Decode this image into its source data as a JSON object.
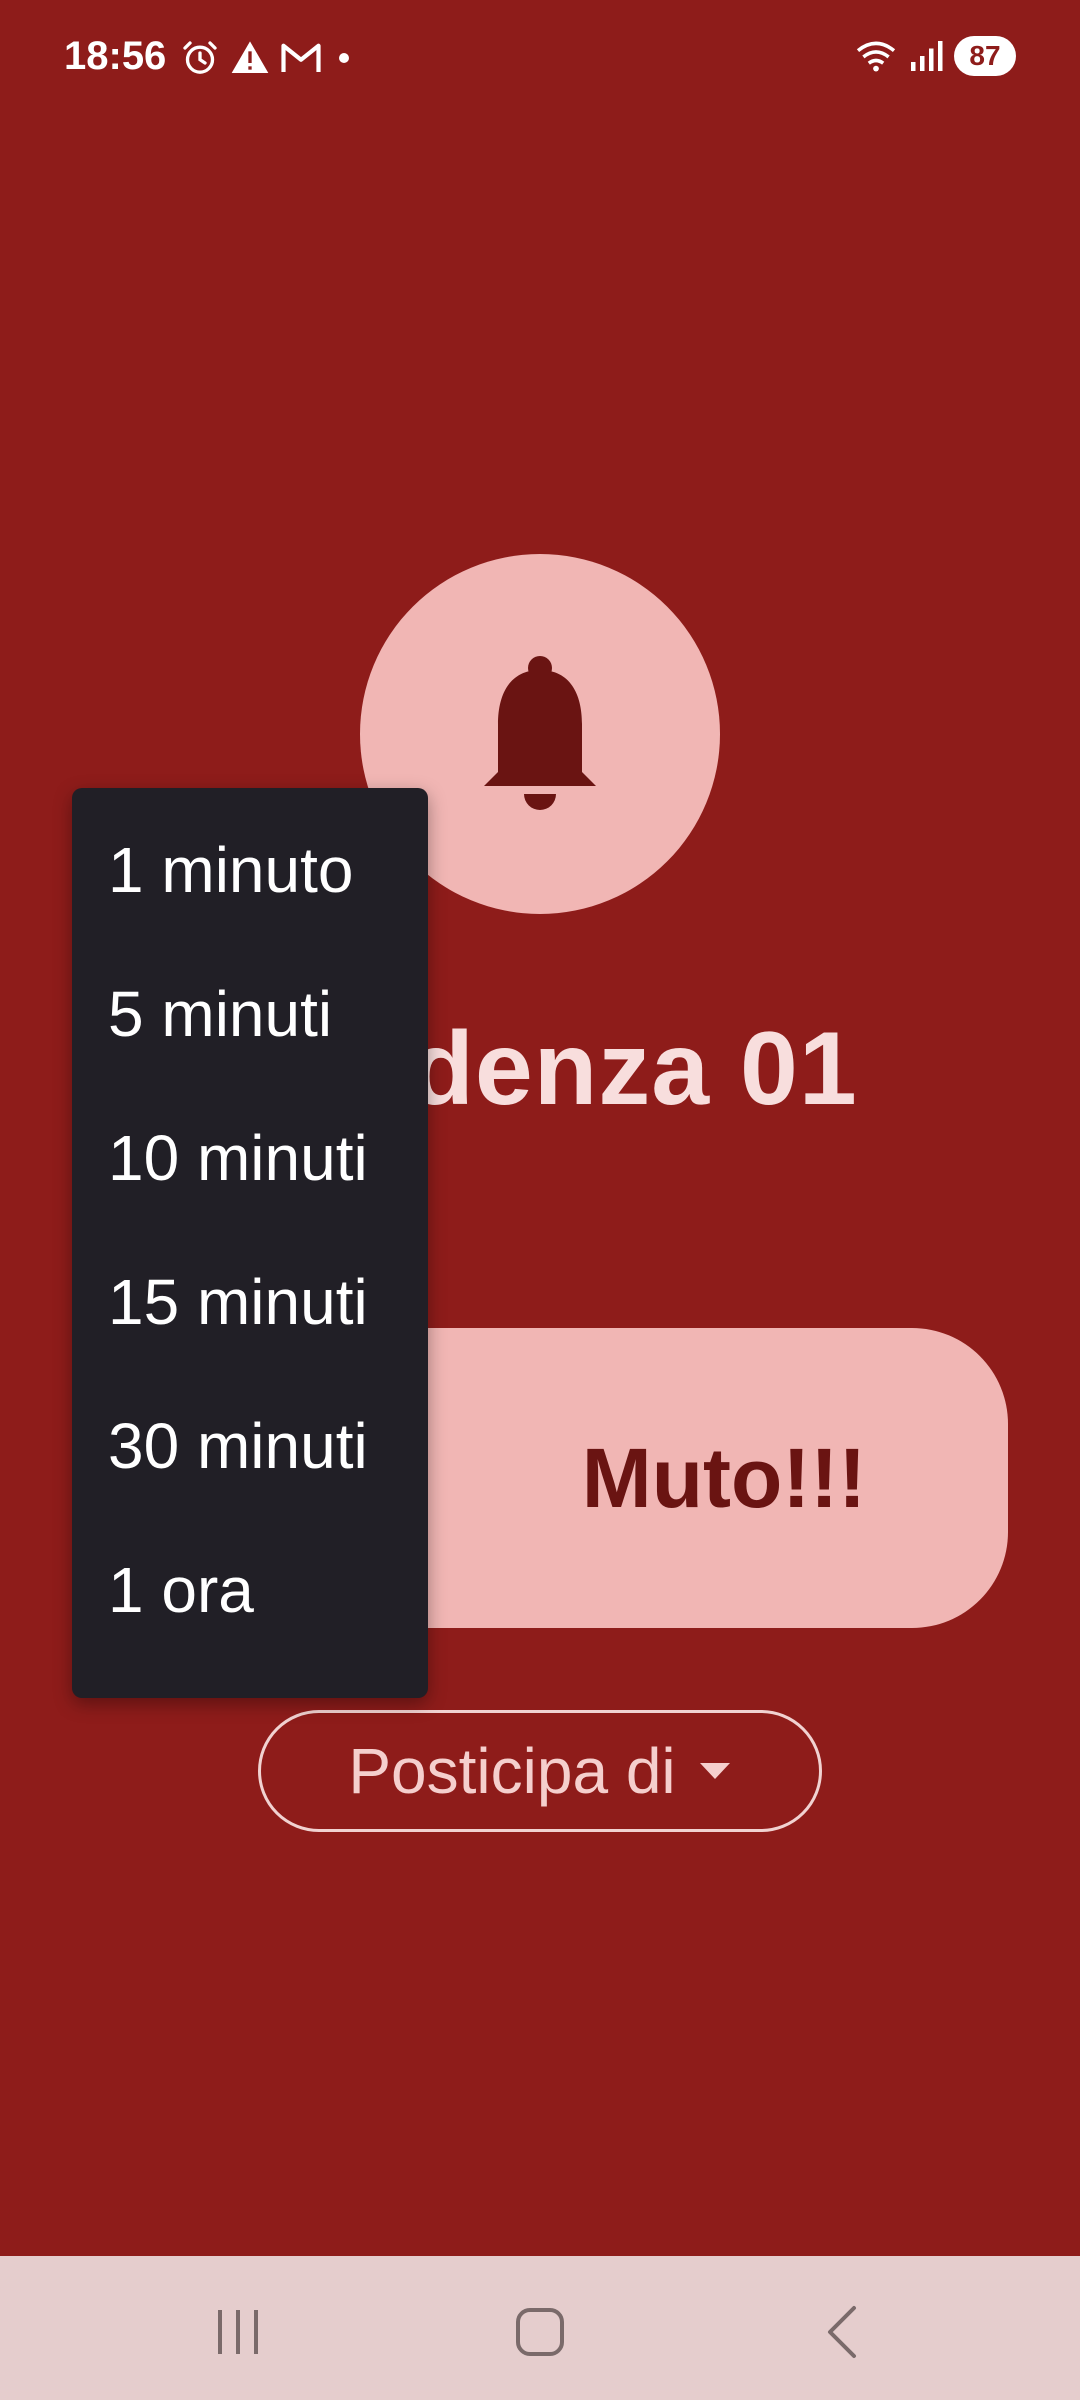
{
  "status_bar": {
    "time": "18:56",
    "battery": "87"
  },
  "alarm": {
    "title": "Scadenza 01",
    "mute_label": "Muto!!!",
    "postpone_label": "Posticipa di"
  },
  "snooze_menu": {
    "items": [
      "1 minuto",
      "5 minuti",
      "10 minuti",
      "15 minuti",
      "30 minuti",
      "1 ora"
    ]
  },
  "colors": {
    "background": "#8e1c1a",
    "accent_light": "#f1b6b4",
    "accent_dark": "#6a1412",
    "menu_bg": "#211f26",
    "navbar_bg": "#e5cdcd"
  },
  "icons": {
    "bell": "bell-icon",
    "alarm": "alarm-clock-icon",
    "warning": "warning-icon",
    "gmail": "gmail-icon",
    "wifi": "wifi-icon",
    "signal": "signal-icon",
    "dropdown": "dropdown-arrow-icon",
    "recents": "recents-icon",
    "home": "home-icon",
    "back": "back-icon"
  }
}
